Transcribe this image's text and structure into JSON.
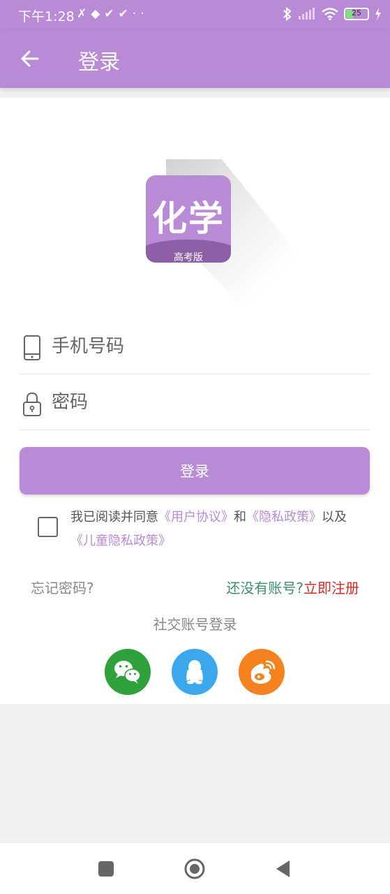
{
  "status_bar": {
    "time": "下午1:28",
    "left_icons": "✗◆✔✔··",
    "battery_level": "25"
  },
  "app_bar": {
    "title": "登录"
  },
  "logo": {
    "main_text": "化学",
    "sub_text": "高考版"
  },
  "form": {
    "phone_placeholder": "手机号码",
    "password_placeholder": "密码",
    "login_label": "登录"
  },
  "agreement": {
    "prefix": "我已阅读并同意",
    "user_agreement": "《用户协议》",
    "and": "和",
    "privacy_policy": "《隐私政策》",
    "also": "以及",
    "child_privacy_policy": "《儿童隐私政策》",
    "checked": false
  },
  "links": {
    "forgot_password": "忘记密码?",
    "no_account": "还没有账号?",
    "register_now": "立即注册"
  },
  "social": {
    "title": "社交账号登录",
    "items": [
      "wechat",
      "qq",
      "weibo"
    ]
  },
  "colors": {
    "primary": "#b98ad6",
    "logo_band": "#8c5fa6",
    "register_green": "#3d8f6b",
    "register_red": "#d42a2a",
    "wechat": "#2fa13a",
    "qq": "#3ba8ee",
    "weibo": "#f5811f"
  }
}
